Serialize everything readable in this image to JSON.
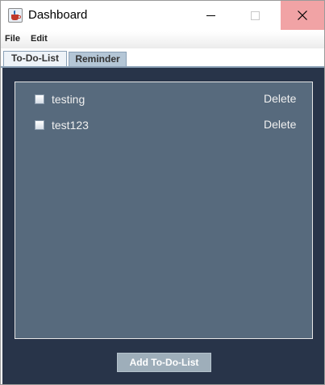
{
  "window": {
    "title": "Dashboard",
    "icon": "java-cup-icon"
  },
  "menu": {
    "items": [
      "File",
      "Edit"
    ]
  },
  "tabs": [
    {
      "label": "To-Do-List",
      "selected": true
    },
    {
      "label": "Reminder",
      "selected": false
    }
  ],
  "todos": [
    {
      "label": "testing",
      "checked": false,
      "delete_label": "Delete"
    },
    {
      "label": "test123",
      "checked": false,
      "delete_label": "Delete"
    }
  ],
  "actions": {
    "add_label": "Add To-Do-List"
  },
  "colors": {
    "content_bg": "#283449",
    "panel_bg": "#576a7d",
    "tab_selected": "#eef3f8",
    "tab_unselected": "#b4c6d6",
    "close_hover": "#f1a3a5",
    "button_bg": "#9eaeba"
  }
}
